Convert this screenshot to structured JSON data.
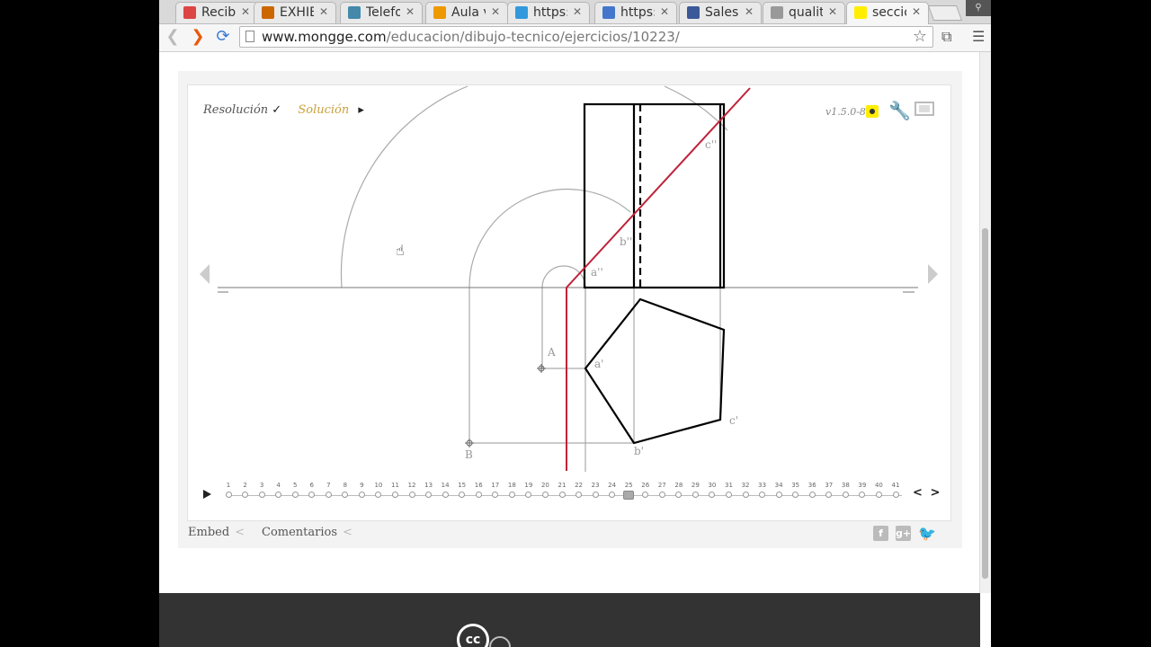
{
  "browser": {
    "tabs": [
      {
        "title": "Recibi",
        "favicon": "gmail-icon",
        "color": "#d44"
      },
      {
        "title": "EXHIB",
        "favicon": "building-icon",
        "color": "#c60"
      },
      {
        "title": "Telefo",
        "favicon": "phone-icon",
        "color": "#48a"
      },
      {
        "title": "Aula v",
        "favicon": "moodle-icon",
        "color": "#e90"
      },
      {
        "title": "https:",
        "favicon": "twitter-icon",
        "color": "#39d"
      },
      {
        "title": "https:",
        "favicon": "google-icon",
        "color": "#47c"
      },
      {
        "title": "Salesi",
        "favicon": "facebook-icon",
        "color": "#3b5998"
      },
      {
        "title": "qualit",
        "favicon": "document-icon",
        "color": "#999"
      },
      {
        "title": "secció",
        "favicon": "mongge-icon",
        "color": "#fe0",
        "active": true
      }
    ],
    "url_host": "www.mongge.com",
    "url_path": "/educacion/dibujo-tecnico/ejercicios/10223/"
  },
  "viewer": {
    "resolucion_label": "Resolución",
    "check": "✓",
    "solucion_label": "Solución",
    "play_glyph": "▸",
    "version": "v1.5.0-8",
    "current_step": 25,
    "nav_prev": "<",
    "nav_next": ">"
  },
  "drawing_labels": {
    "a2": "a''",
    "b2": "b''",
    "c2": "c''",
    "a1": "a'",
    "b1": "b'",
    "c1": "c'",
    "A": "A",
    "B": "B"
  },
  "bottom": {
    "embed_label": "Embed",
    "comments_label": "Comentarios",
    "chevron": "<"
  },
  "footer": {
    "cc_label": "cc"
  },
  "colors": {
    "section_line": "#c0223a",
    "solution_gold": "#c9a23a"
  }
}
